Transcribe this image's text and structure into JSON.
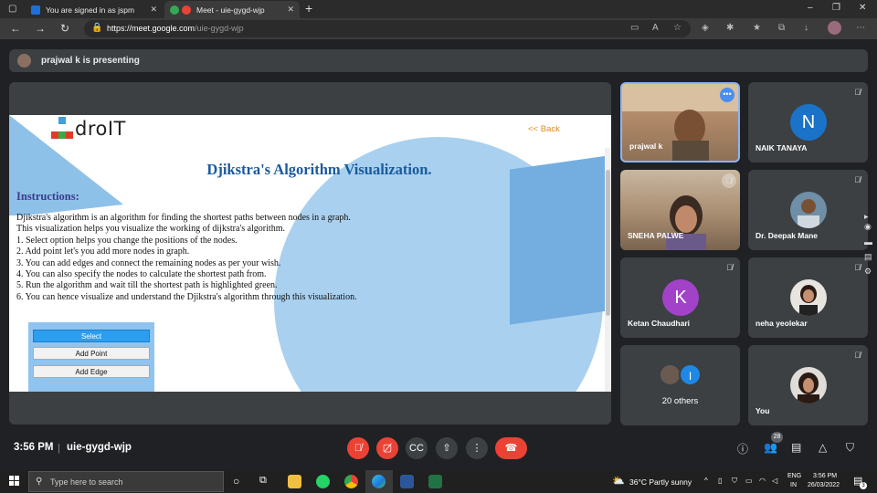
{
  "browser": {
    "tabs": [
      {
        "title": "You are signed in as jspm",
        "favicon_color": "#1e6fd9"
      },
      {
        "title": "Meet - uie-gygd-wjp",
        "favicon_color": "#ea4335"
      }
    ],
    "new_tab": "+",
    "url_host": "https://meet.google.com",
    "url_path": "/uie-gygd-wjp",
    "window_controls": [
      "–",
      "❐",
      "✕"
    ]
  },
  "meet": {
    "presenting_text": "prajwal k is presenting",
    "shared_page": {
      "back_link": "<< Back",
      "logo_text": "droIT",
      "title": "Djikstra's Algorithm Visualization.",
      "instructions_heading": "Instructions:",
      "instructions": [
        "Djikstra's algorithm is an algorithm for finding the shortest paths between nodes in a graph.",
        "This visualization helps you visualize the working of dijkstra's algorithm.",
        "1. Select option helps you change the positions of the nodes.",
        "2. Add point let's you add more nodes in graph.",
        "3. You can add edges and connect the remaining nodes as per your wish.",
        "4. You can also specify the nodes to calculate the shortest path from.",
        "5. Run the algorithm and wait till the shortest path is highlighted green.",
        "6. You can hence visualize and understand the Djikstra's algorithm through this visualization."
      ],
      "buttons": [
        "Select",
        "Add Point",
        "Add Edge"
      ]
    },
    "participants": [
      {
        "name": "prajwal k",
        "type": "video"
      },
      {
        "name": "NAIK TANAYA",
        "letter": "N",
        "color": "#1a73c8"
      },
      {
        "name": "SNEHA PALWE",
        "type": "video"
      },
      {
        "name": "Dr. Deepak Mane",
        "type": "photo"
      },
      {
        "name": "Ketan Chaudhari",
        "letter": "K",
        "color": "#a142c9"
      },
      {
        "name": "neha yeolekar",
        "type": "photo"
      },
      {
        "name": "20 others",
        "letter": "I",
        "color": "#1e88e5"
      },
      {
        "name": "You",
        "type": "photo"
      }
    ],
    "bottom": {
      "time": "3:56 PM",
      "separator": "|",
      "meeting_code": "uie-gygd-wjp",
      "participant_count": "28"
    }
  },
  "taskbar": {
    "search_placeholder": "Type here to search",
    "weather": "36°C  Partly sunny",
    "lang_top": "ENG",
    "lang_bottom": "IN",
    "clock_time": "3:56 PM",
    "clock_date": "26/03/2022",
    "notification_count": "3"
  }
}
